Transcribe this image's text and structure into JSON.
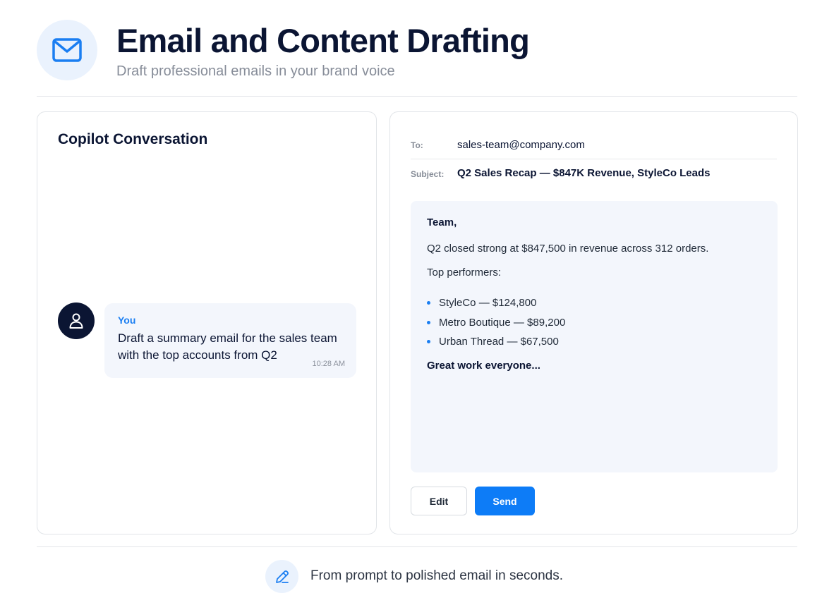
{
  "header": {
    "icon": "mail-icon",
    "title": "Email and Content Drafting",
    "subtitle": "Draft professional emails in your brand voice"
  },
  "conversation": {
    "title": "Copilot Conversation",
    "messages": [
      {
        "sender": "You",
        "avatar_icon": "user-icon",
        "text": "Draft a summary email for the sales team with the top accounts from Q2",
        "time": "10:28 AM"
      }
    ]
  },
  "email": {
    "to_label": "To:",
    "to_value": "sales-team@company.com",
    "subject_label": "Subject:",
    "subject_value": "Q2 Sales Recap — $847K Revenue, StyleCo Leads",
    "body": {
      "greeting": "Team,",
      "paragraph1": "Q2 closed strong at $847,500 in revenue across 312 orders.",
      "paragraph2": "Top performers:",
      "bullets": [
        "StyleCo — $124,800",
        "Metro Boutique — $89,200",
        "Urban Thread — $67,500"
      ],
      "closing": "Great work everyone..."
    },
    "edit_label": "Edit",
    "send_label": "Send"
  },
  "footer": {
    "icon": "pencil-icon",
    "text": "From prompt to polished email in seconds."
  },
  "colors": {
    "accent": "#0d7cf7",
    "navy": "#0b1533",
    "icon_bg": "#eaf2fd",
    "bubble_bg": "#f3f6fc"
  }
}
